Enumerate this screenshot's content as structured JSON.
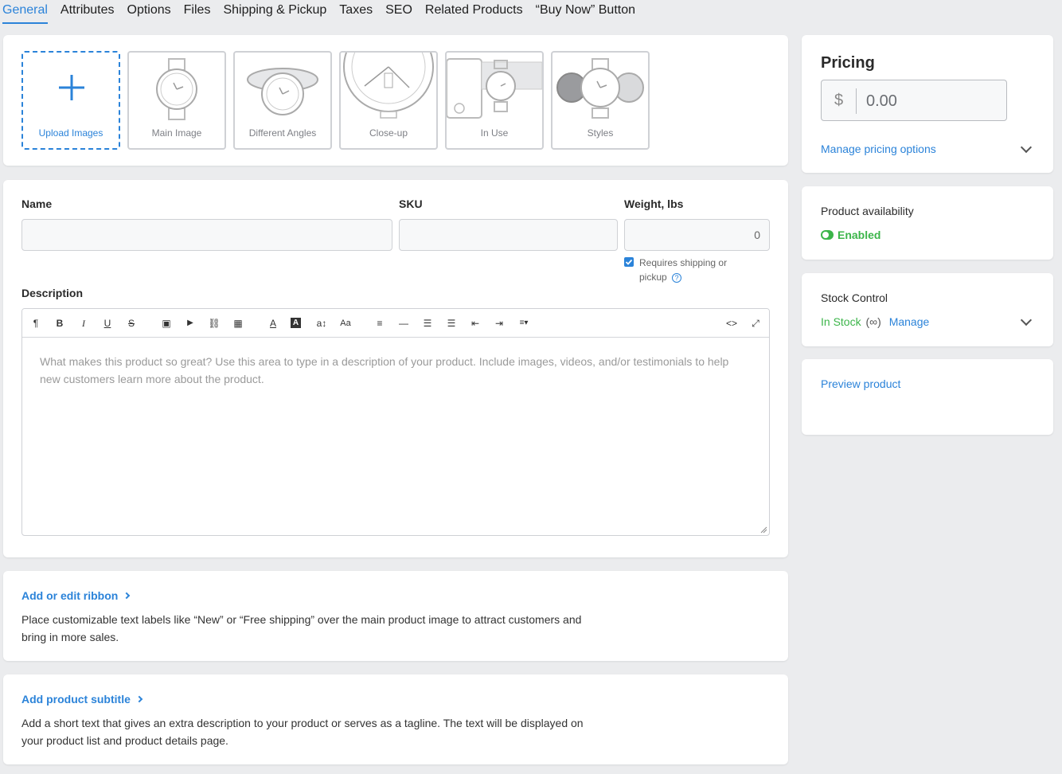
{
  "tabs": [
    "General",
    "Attributes",
    "Options",
    "Files",
    "Shipping & Pickup",
    "Taxes",
    "SEO",
    "Related Products",
    "“Buy Now” Button"
  ],
  "gallery": {
    "upload_label": "Upload Images",
    "items": [
      "Main Image",
      "Different Angles",
      "Close-up",
      "In Use",
      "Styles"
    ]
  },
  "form": {
    "name_label": "Name",
    "sku_label": "SKU",
    "weight_label": "Weight, lbs",
    "weight_value": "0",
    "shipping_check_label": "Requires shipping or pickup",
    "description_label": "Description",
    "description_placeholder": "What makes this product so great? Use this area to type in a description of your product. Include images, videos, and/or testimonials to help new customers learn more about the product."
  },
  "toolbar": {
    "paragraph": "¶",
    "bold": "B",
    "italic": "I",
    "underline": "U",
    "strike": "S",
    "image": "▣",
    "video": "▶",
    "link": "⛓",
    "table": "▦",
    "font_color": "A",
    "bg_color": "A",
    "font_size": "a↕",
    "font_family": "Aa",
    "align": "≡",
    "hr": "—",
    "ul": "☰",
    "ol": "☰",
    "outdent": "⇤",
    "indent": "⇥",
    "more": "≡▾",
    "code": "<>",
    "fullscreen": "⤢"
  },
  "ribbon": {
    "link": "Add or edit ribbon",
    "text": "Place customizable text labels like “New” or “Free shipping” over the main product image to attract customers and bring in more sales."
  },
  "subtitle": {
    "link": "Add product subtitle",
    "text": "Add a short text that gives an extra description to your product or serves as a tagline. The text will be displayed on your product list and product details page."
  },
  "pricing": {
    "title": "Pricing",
    "currency": "$",
    "placeholder": "0.00",
    "manage_link": "Manage pricing options"
  },
  "availability": {
    "title": "Product availability",
    "status": "Enabled"
  },
  "stock": {
    "title": "Stock Control",
    "status": "In Stock",
    "infinity": "(∞)",
    "manage_link": "Manage"
  },
  "preview": {
    "link": "Preview product"
  },
  "colors": {
    "accent": "#2b83d9",
    "success": "#3cb54a"
  }
}
